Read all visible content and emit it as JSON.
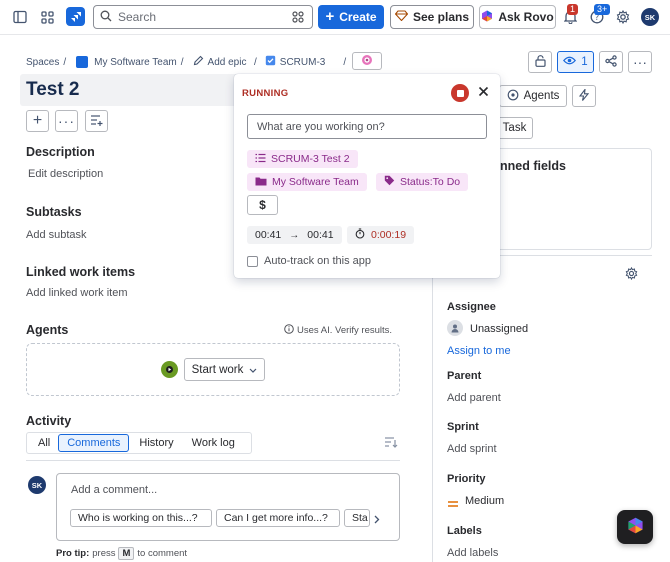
{
  "topbar": {
    "search_placeholder": "Search",
    "create_label": "Create",
    "plans_label": "See plans",
    "rovo_label": "Ask Rovo",
    "notif_count": "1",
    "help_count": "3+",
    "avatar_initials": "SK",
    "colors": {
      "create": "#1868db",
      "badge_red": "#c9372c",
      "badge_blue": "#1868db"
    }
  },
  "breadcrumb": {
    "spaces": "Spaces",
    "team": "My Software Team",
    "add_epic": "Add epic",
    "issue_key": "SCRUM-3",
    "sep": "/"
  },
  "issue": {
    "title": "Test 2"
  },
  "header_right": {
    "watch_count": "1",
    "agents_label": "Agents",
    "task_label": "Task",
    "pinned_fields": "nned fields"
  },
  "sections": {
    "description": "Description",
    "edit_description": "Edit description",
    "subtasks": "Subtasks",
    "add_subtask": "Add subtask",
    "linked": "Linked work items",
    "add_linked": "Add linked work item",
    "agents": "Agents",
    "ai_notice": "Uses AI. Verify results.",
    "start_work": "Start work"
  },
  "activity": {
    "title": "Activity",
    "tabs": [
      "All",
      "Comments",
      "History",
      "Work log"
    ],
    "comment_placeholder": "Add a comment...",
    "avatar_initials": "SK",
    "chips": [
      "Who is working on this...?",
      "Can I get more info...?",
      "Sta"
    ],
    "pro_tip_label": "Pro tip:",
    "pro_tip_text1": "press",
    "pro_tip_key": "M",
    "pro_tip_text2": "to comment"
  },
  "details": {
    "assignee_label": "Assignee",
    "assignee_value": "Unassigned",
    "assign_to_me": "Assign to me",
    "parent_label": "Parent",
    "parent_value": "Add parent",
    "sprint_label": "Sprint",
    "sprint_value": "Add sprint",
    "priority_label": "Priority",
    "priority_value": "Medium",
    "labels_label": "Labels",
    "labels_value": "Add labels"
  },
  "timer": {
    "status": "RUNNING",
    "input_placeholder": "What are you working on?",
    "issue_pill": "SCRUM-3 Test 2",
    "project_pill": "My Software Team",
    "status_pill": "Status:To Do",
    "billable_symbol": "$",
    "time_start": "00:41",
    "arrow": "→",
    "time_end": "00:41",
    "duration": "0:00:19",
    "autotrack_label": "Auto-track on this app",
    "colors": {
      "status_text": "#ae2e24",
      "stop_button": "#c9372c",
      "pill_bg": "#f8e6f8",
      "pill_text": "#8a2a8a"
    }
  }
}
